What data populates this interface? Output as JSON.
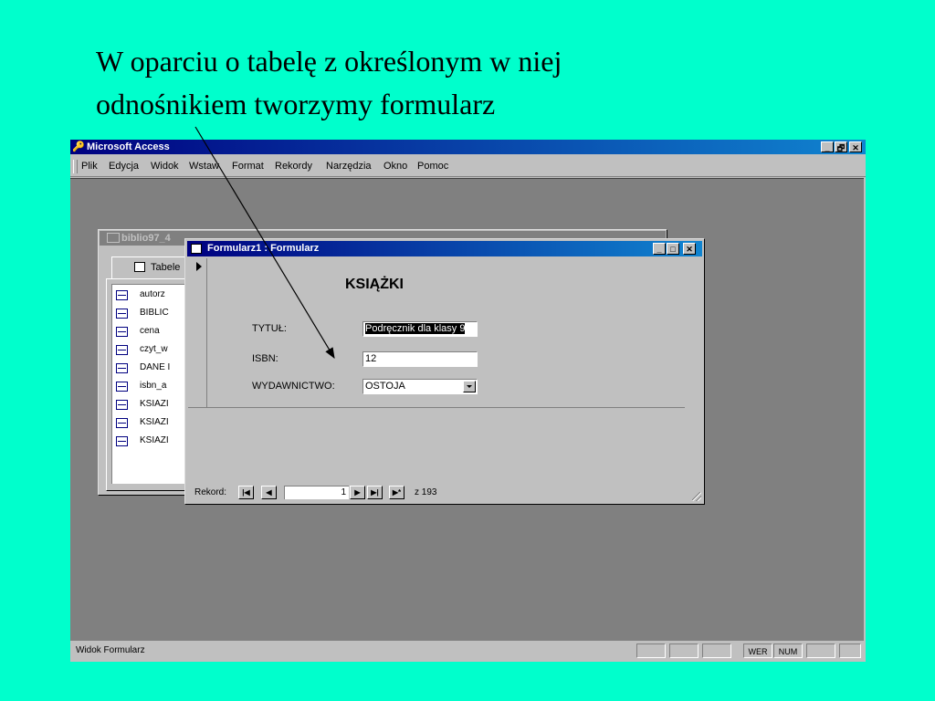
{
  "slide": {
    "title_line1": "W oparciu o tabelę z określonym w niej",
    "title_line2": "odnośnikiem tworzymy formularz"
  },
  "app": {
    "title": "Microsoft Access",
    "window_buttons": [
      "_",
      "🗗",
      "✕"
    ],
    "menu": [
      "Plik",
      "Edycja",
      "Widok",
      "Wstaw",
      "Format",
      "Rekordy",
      "Narzędzia",
      "Okno",
      "Pomoc"
    ],
    "status": {
      "text": "Widok Formularz",
      "indicators": [
        "WER",
        "NUM"
      ]
    }
  },
  "db_window": {
    "title": "biblio97_4",
    "tab_label": "Tabele",
    "tables": [
      "autorz",
      "BIBLIC",
      "cena",
      "czyt_w",
      "DANE I",
      "isbn_a",
      "KSIAZI",
      "KSIAZI",
      "KSIAZI"
    ]
  },
  "form_window": {
    "title": "Formularz1 : Formularz",
    "heading": "KSIĄŻKI",
    "fields": {
      "tytul_label": "TYTUŁ:",
      "tytul_value": "Podręcznik dla klasy 9",
      "isbn_label": "ISBN:",
      "isbn_value": "12",
      "wydawnictwo_label": "WYDAWNICTWO:",
      "wydawnictwo_value": "OSTOJA"
    },
    "navigation": {
      "label": "Rekord:",
      "current": "1",
      "total": "z 193"
    }
  },
  "colors": {
    "slide_background": "#00FFCC",
    "titlebar_active": "#000080",
    "workspace": "#808080",
    "chrome": "#C0C0C0"
  }
}
